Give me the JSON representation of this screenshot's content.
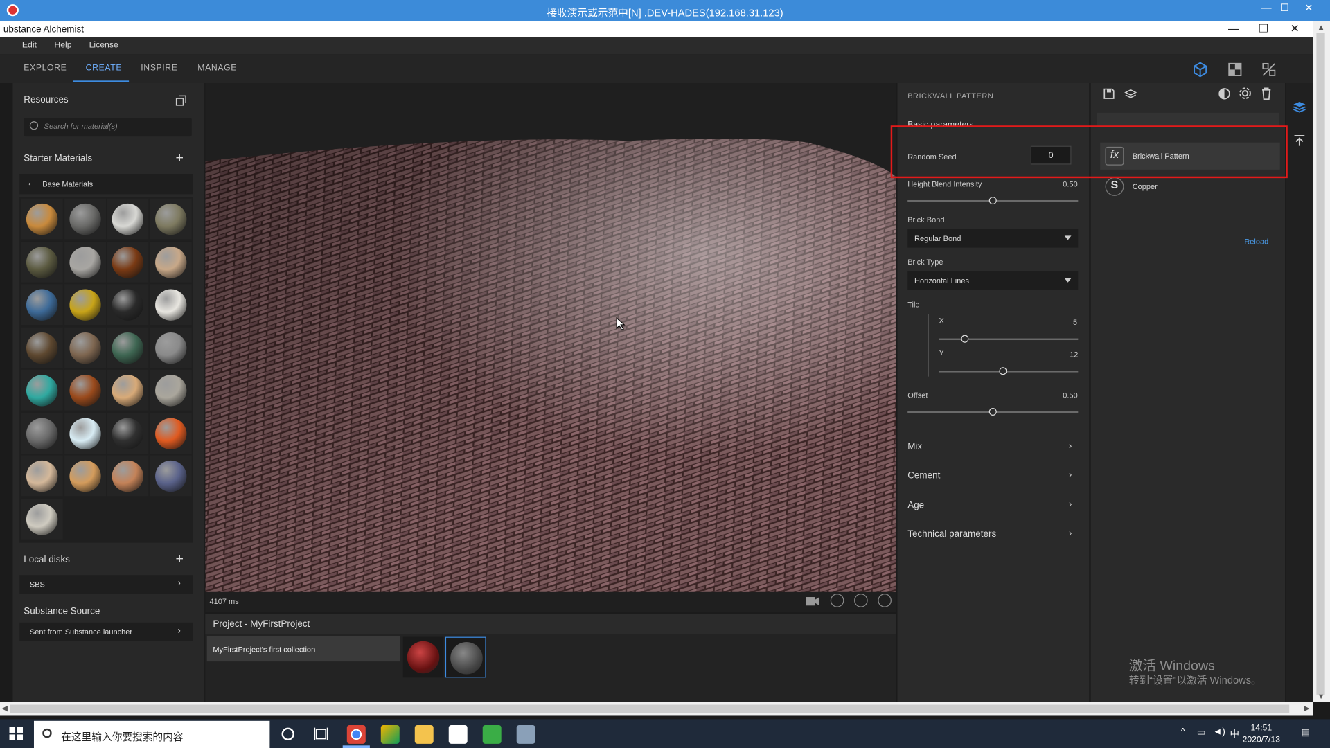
{
  "remote": {
    "title": "接收演示或示范中[N] .DEV-HADES(192.168.31.123)"
  },
  "window": {
    "title": "ubstance Alchemist"
  },
  "menu": [
    "Edit",
    "Help",
    "License"
  ],
  "tabs": [
    "EXPLORE",
    "CREATE",
    "INSPIRE",
    "MANAGE"
  ],
  "active_tab": "CREATE",
  "resources": {
    "title": "Resources",
    "search_placeholder": "Search for material(s)",
    "starter_title": "Starter Materials",
    "base_label": "Base Materials",
    "materials": [
      "#c98a3c",
      "#6a6a68",
      "#d8d8d4",
      "#7e7a60",
      "#5b5a40",
      "#a8a6a2",
      "#7a3a14",
      "#c8a888",
      "#3d6a98",
      "#c8a418",
      "#2a2a2a",
      "#e8e6e0",
      "#5e4830",
      "#7e6650",
      "#3e6652",
      "#8a8a8a",
      "#2fa9a0",
      "#9a4a1c",
      "#d8aa78",
      "#aaa69c",
      "#6a6a6a",
      "#d8ecf4",
      "#303030",
      "#e05a20",
      "#d4b89a",
      "#d49c5c",
      "#c48258",
      "#5a628a",
      "#cfcbc0"
    ]
  },
  "local_disks": {
    "title": "Local disks",
    "item": "SBS"
  },
  "substance_source": {
    "title": "Substance Source",
    "item": "Sent from Substance launcher"
  },
  "viewport": {
    "timing": "4107 ms"
  },
  "project": {
    "title": "Project - MyFirstProject",
    "collection": "MyFirstProject's first collection"
  },
  "params": {
    "title": "BRICKWALL PATTERN",
    "basic": "Basic parameters",
    "random_seed_label": "Random Seed",
    "random_seed": "0",
    "height_blend_label": "Height Blend Intensity",
    "height_blend": "0.50",
    "height_blend_fraction": 0.5,
    "brick_bond_label": "Brick Bond",
    "brick_bond": "Regular Bond",
    "brick_type_label": "Brick Type",
    "brick_type": "Horizontal Lines",
    "tile_label": "Tile",
    "tile_x_label": "X",
    "tile_x": "5",
    "tile_y_label": "Y",
    "tile_y": "12",
    "offset_label": "Offset",
    "offset": "0.50",
    "sections": [
      "Mix",
      "Cement",
      "Age",
      "Technical parameters"
    ]
  },
  "layers": {
    "items": [
      {
        "icon": "fx",
        "name": "Brickwall Pattern"
      },
      {
        "icon": "S",
        "name": "Copper"
      }
    ],
    "reload": "Reload"
  },
  "watermark": {
    "line1": "激活 Windows",
    "line2": "转到“设置”以激活 Windows。"
  },
  "taskbar": {
    "search": "在这里输入你要搜索的内容",
    "ime": "中",
    "time": "14:51",
    "date": "2020/7/13"
  }
}
